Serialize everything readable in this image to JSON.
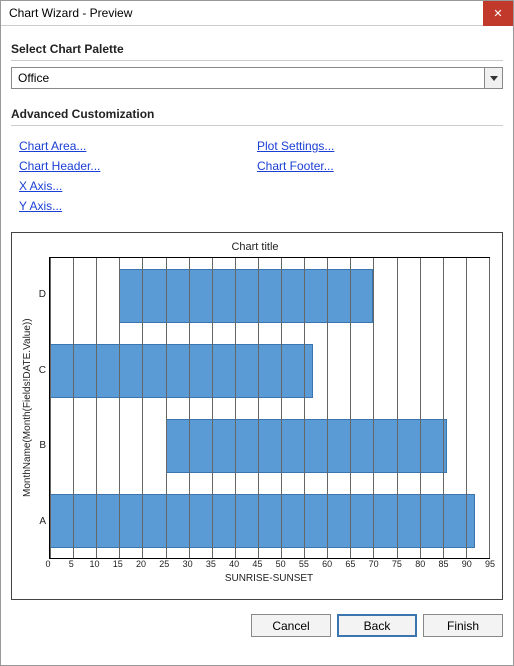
{
  "window": {
    "title": "Chart Wizard - Preview"
  },
  "section_palette": "Select Chart Palette",
  "palette_value": "Office",
  "section_advanced": "Advanced Customization",
  "links_left": [
    {
      "label": "Chart Area..."
    },
    {
      "label": "Chart Header..."
    },
    {
      "label": "X Axis..."
    },
    {
      "label": "Y Axis..."
    }
  ],
  "links_right": [
    {
      "label": "Plot Settings..."
    },
    {
      "label": "Chart Footer..."
    }
  ],
  "chart_data": {
    "type": "bar",
    "orientation": "horizontal",
    "title": "Chart title",
    "xlabel": "SUNRISE-SUNSET",
    "ylabel": "MonthName(Month(Fields!DATE.Value))",
    "xlim": [
      0,
      95
    ],
    "x_ticks": [
      0,
      5,
      10,
      15,
      20,
      25,
      30,
      35,
      40,
      45,
      50,
      55,
      60,
      65,
      70,
      75,
      80,
      85,
      90,
      95
    ],
    "categories": [
      "D",
      "C",
      "B",
      "A"
    ],
    "series": [
      {
        "name": "D",
        "start": 15,
        "end": 70
      },
      {
        "name": "C",
        "start": 0,
        "end": 57
      },
      {
        "name": "B",
        "start": 25,
        "end": 86
      },
      {
        "name": "A",
        "start": 0,
        "end": 92
      }
    ],
    "bar_color": "#5b9bd5"
  },
  "buttons": {
    "cancel": "Cancel",
    "back": "Back",
    "finish": "Finish"
  }
}
